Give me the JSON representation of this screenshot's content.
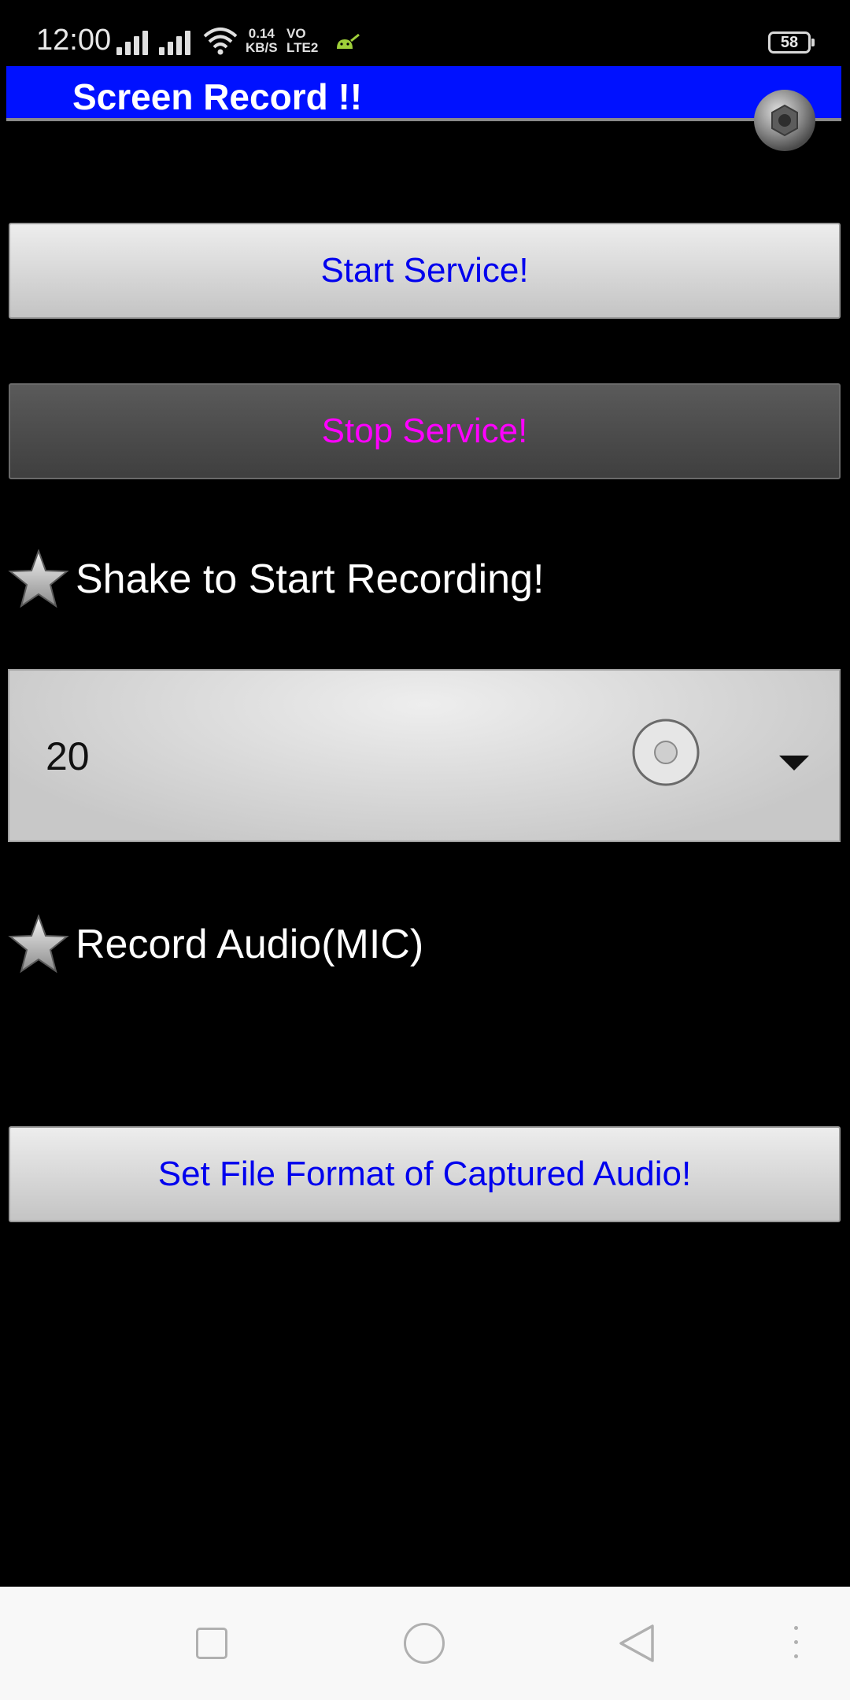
{
  "status_bar": {
    "time": "12:00",
    "net_speed_value": "0.14",
    "net_speed_unit": "KB/S",
    "volte_top": "VO",
    "volte_bottom": "LTE2",
    "battery": "58"
  },
  "app_bar": {
    "title": "Screen Record !!"
  },
  "buttons": {
    "start_label": "Start Service!",
    "stop_label": "Stop Service!",
    "format_label": "Set File Format of Captured Audio!"
  },
  "options": {
    "shake_label": "Shake to Start Recording!",
    "audio_label": "Record Audio(MIC)"
  },
  "spinner": {
    "value": "20"
  },
  "colors": {
    "app_bar": "#0011ff",
    "start_text": "#0000ee",
    "stop_text": "#ff00ff"
  },
  "icons": [
    "signal-icon",
    "wifi-icon",
    "android-icon",
    "battery-icon",
    "camera-icon",
    "star-icon",
    "radio-icon",
    "dropdown-icon",
    "recent-apps-icon",
    "home-icon",
    "back-icon",
    "menu-icon"
  ]
}
